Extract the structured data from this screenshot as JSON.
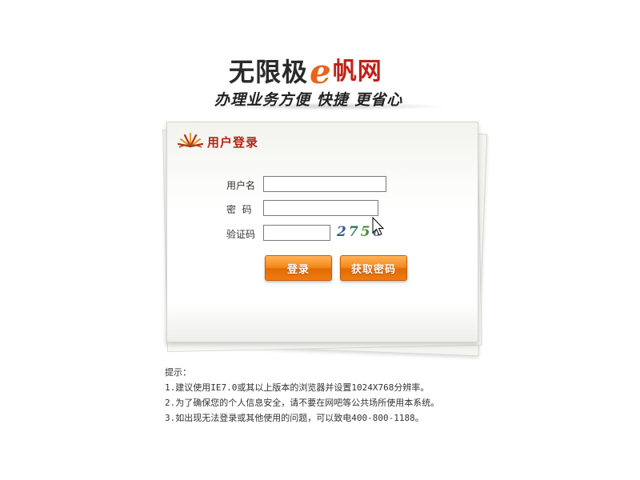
{
  "brand": {
    "name_part1": "无限极",
    "e_letter": "e",
    "name_part2": "帆网",
    "slogan": "办理业务方便  快捷  更省心",
    "colors": {
      "e_letter": "#e8641b",
      "name_part2": "#c0201a",
      "title": "#b02515",
      "button": "#f58a1c"
    }
  },
  "login": {
    "title": "用户登录",
    "title_icon": "sun-rays-icon",
    "username_label": "用户名",
    "username_value": "",
    "password_label": "密  码",
    "password_value": "",
    "captcha_label": "验证码",
    "captcha_value": "",
    "captcha_chars": [
      "2",
      "7",
      "5",
      "6"
    ],
    "login_button": "登录",
    "retrieve_button": "获取密码"
  },
  "tips": {
    "heading": "提示：",
    "lines": [
      "1.建议使用IE7.0或其以上版本的浏览器并设置1024X768分辨率。",
      "2.为了确保您的个人信息安全，请不要在网吧等公共场所使用本系统。",
      "3.如出现无法登录或其他使用的问题，可以致电400-800-1188。"
    ]
  }
}
